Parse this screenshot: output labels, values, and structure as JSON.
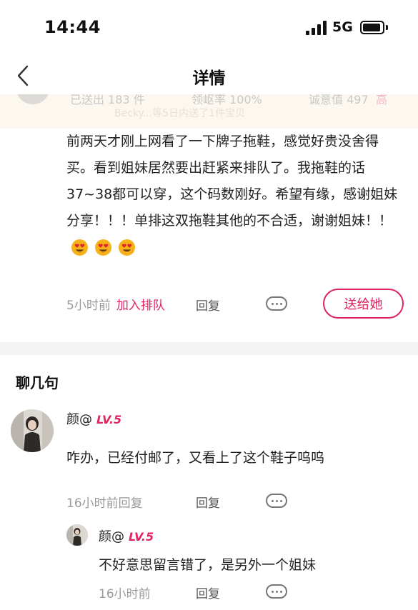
{
  "status_bar": {
    "time": "14:44",
    "network": "5G"
  },
  "nav": {
    "title": "详情",
    "back_icon": "chevron-left-icon"
  },
  "stats": {
    "sent": "已送出 183 件",
    "rate": "领岖率 100%",
    "honesty": "诚意值 497",
    "honesty_tag": "高",
    "notice": "Becky...等5日内送了1件宝贝"
  },
  "post": {
    "body": "前两天才刚上网看了一下牌子拖鞋，感觉好贵没舍得买。看到姐妹居然要出赶紧来排队了。我拖鞋的话37~38都可以穿，这个码数刚好。希望有缘，感谢姐妹分享！！！单排这双拖鞋其他的不合适，谢谢姐妹！！",
    "emojis": [
      "heart-eyes-emoji",
      "heart-eyes-emoji",
      "heart-eyes-emoji"
    ],
    "time": "5小时前",
    "join_queue": "加入排队",
    "reply": "回复",
    "gift_button": "送给她"
  },
  "chat": {
    "title": "聊几句",
    "comments": [
      {
        "user": "颜@",
        "level": "LV.5",
        "text": "咋办，已经付邮了，又看上了这个鞋子呜呜",
        "time": "16小时前回复",
        "reply": "回复"
      }
    ],
    "replies": [
      {
        "user": "颜@",
        "level": "LV.5",
        "text": "不好意思留言错了，是另外一个姐妹",
        "time": "16小时前",
        "reply": "回复"
      }
    ]
  },
  "colors": {
    "accent": "#e0245e",
    "muted": "#9a9a9a",
    "divider": "#f3f3f3"
  }
}
